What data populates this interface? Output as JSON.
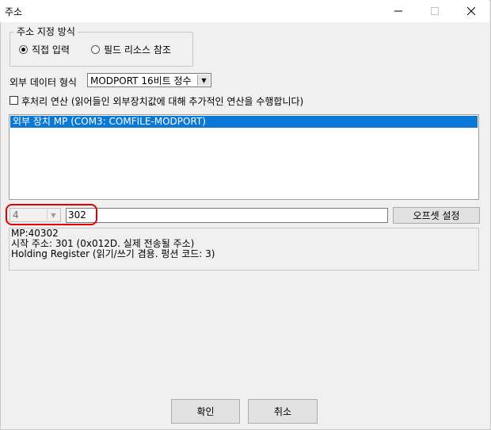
{
  "window": {
    "title": "주소"
  },
  "address_mode": {
    "label": "주소 지정 방식",
    "options": [
      "직접 입력",
      "필드 리소스 참조"
    ],
    "selected": "직접 입력"
  },
  "data_format": {
    "label": "외부 데이터 형식",
    "value": "MODPORT 16비트 정수"
  },
  "postprocess": {
    "label": "후처리 연산 (읽어들인 외부장치값에 대해 추가적인 연산을 수행합니다)",
    "checked": false
  },
  "device_list": {
    "items": [
      "외부 장치 MP (COM3: COMFILE-MODPORT)"
    ],
    "selected_index": 0
  },
  "address_input": {
    "type_value": "4",
    "address_value": "302"
  },
  "offset_button": {
    "label": "오프셋 설정"
  },
  "info": {
    "lines": [
      "MP:40302",
      "시작 주소: 301 (0x012D. 실제 전송될 주소)",
      "Holding Register (읽기/쓰기 겸용. 펑션 코드: 3)"
    ]
  },
  "footer": {
    "ok_label": "확인",
    "cancel_label": "취소"
  },
  "colors": {
    "selection": "#0a78d7",
    "highlight": "#e00000"
  }
}
